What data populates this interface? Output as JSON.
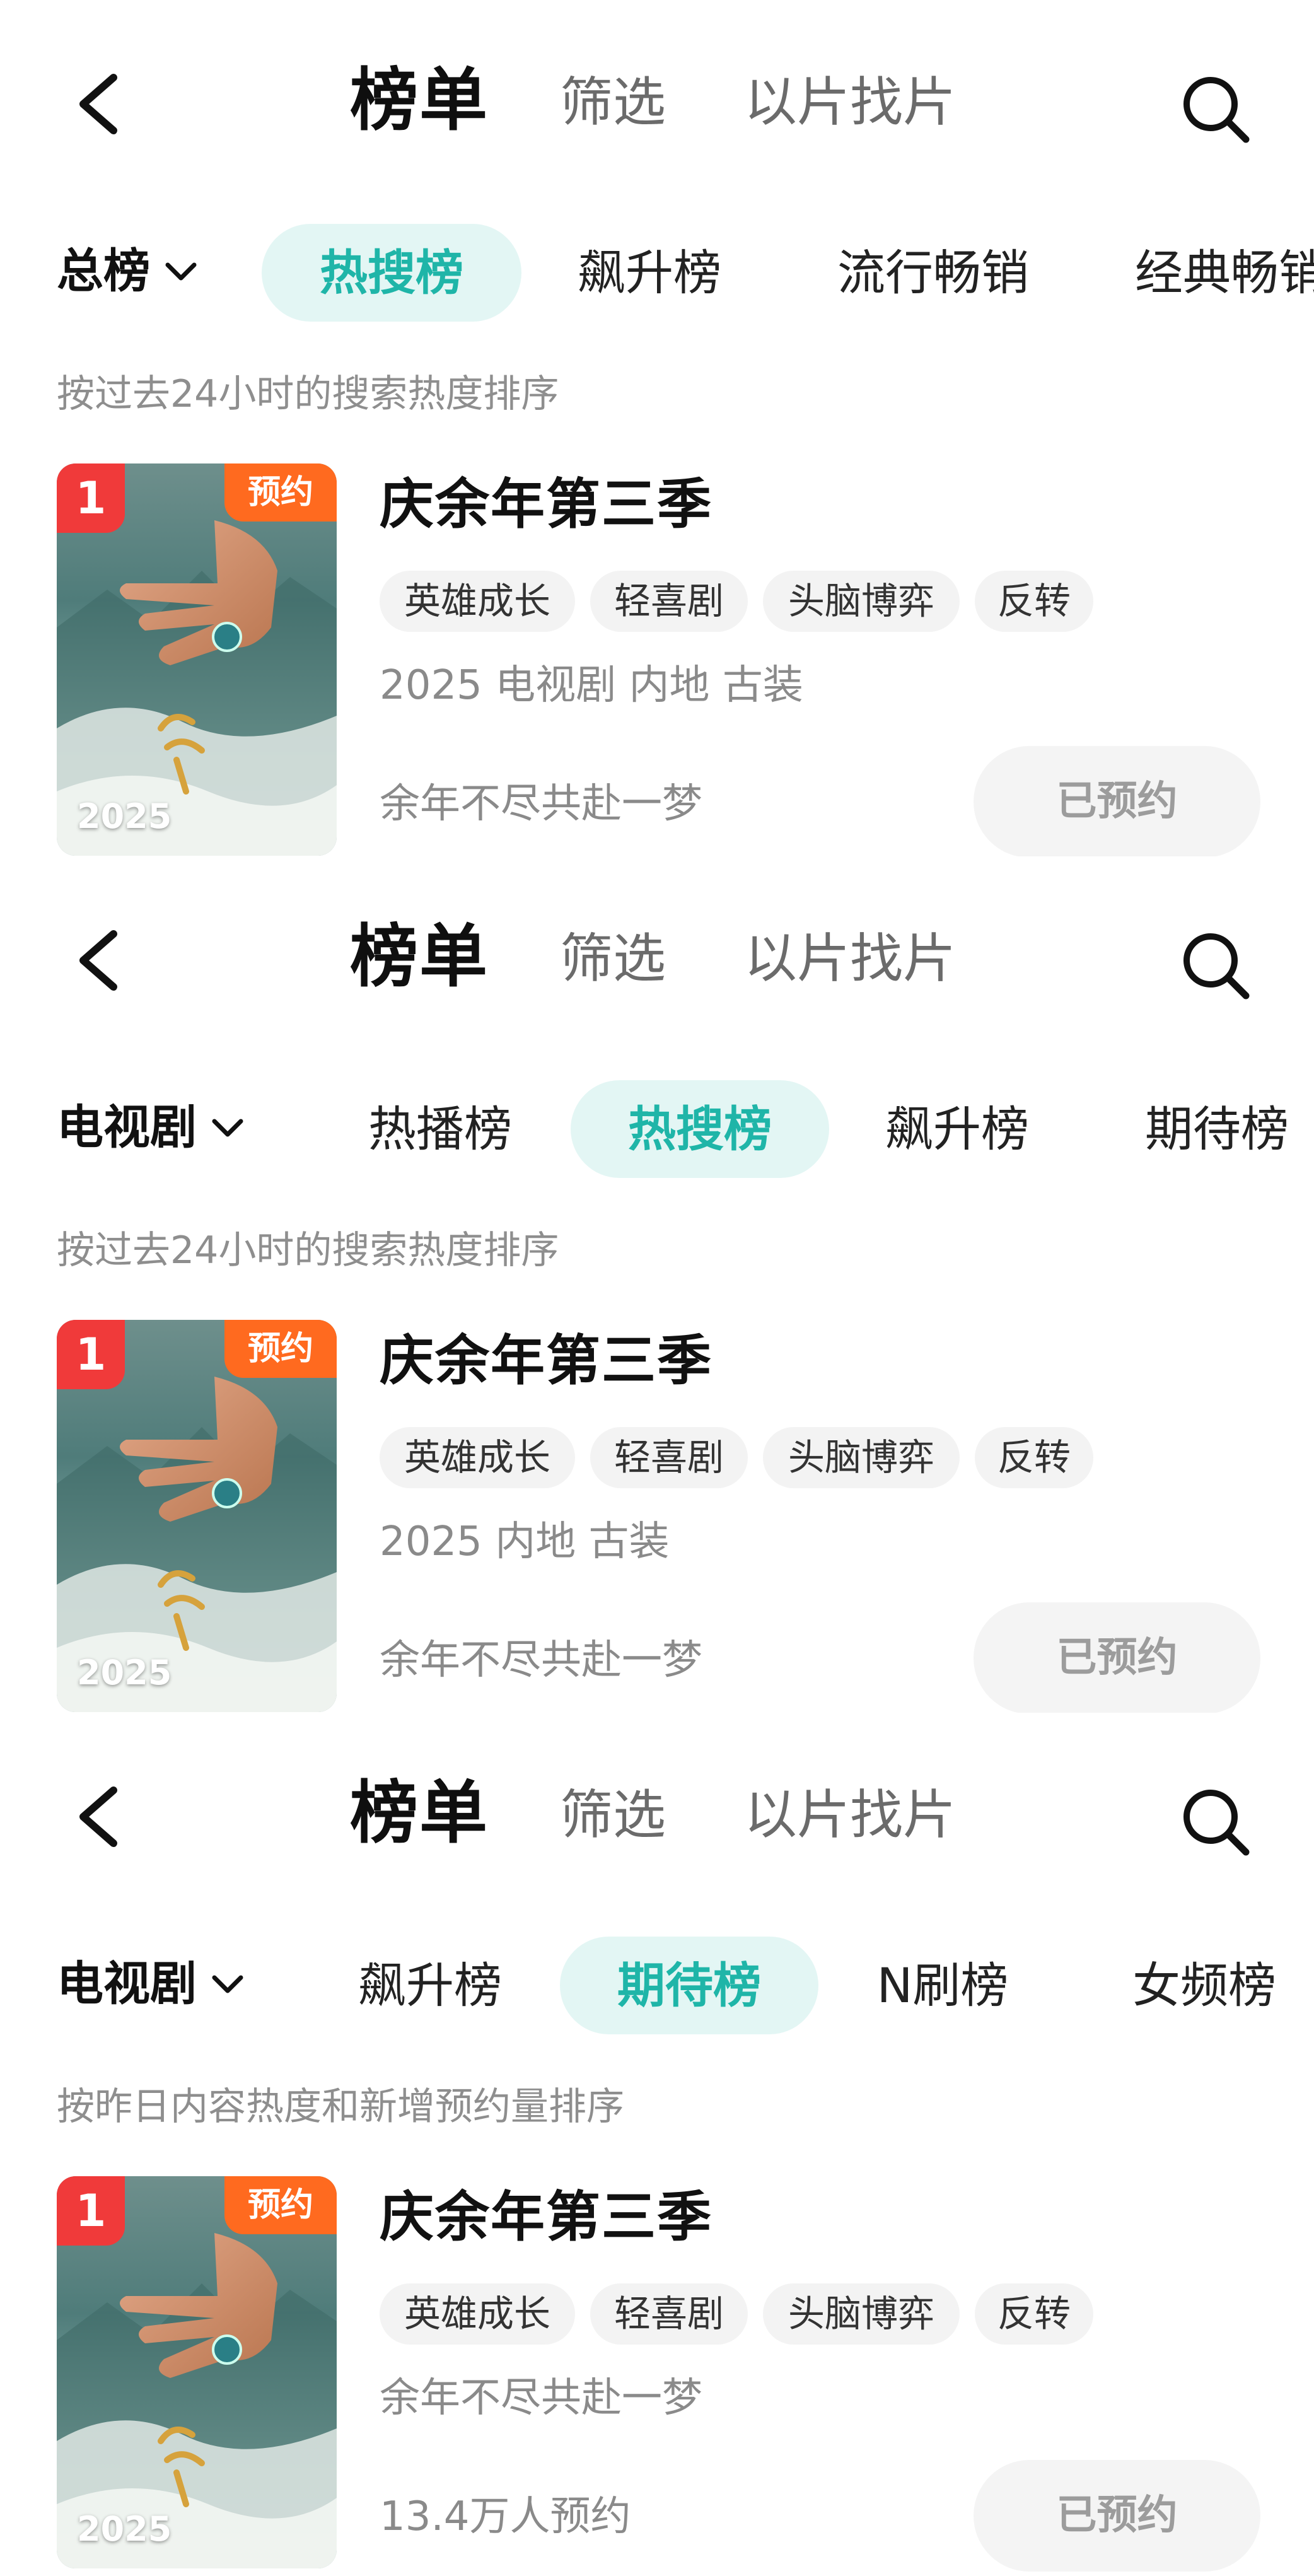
{
  "header": {
    "title": "榜单",
    "tabs": [
      "筛选",
      "以片找片"
    ],
    "back_icon": "chevron-left-icon",
    "search_icon": "search-icon"
  },
  "panels": [
    {
      "category": "总榜",
      "chips": [
        "热搜榜",
        "飙升榜",
        "流行畅销",
        "经典畅销"
      ],
      "active_chip": "热搜榜",
      "description": "按过去24小时的搜索热度排序",
      "card": {
        "rank": "1",
        "badge": "预约",
        "poster_year": "2025",
        "title": "庆余年第三季",
        "tags": [
          "英雄成长",
          "轻喜剧",
          "头脑博弈",
          "反转"
        ],
        "meta1": "2025 电视剧 内地 古装",
        "meta2": "余年不尽共赴一梦",
        "button": "已预约"
      }
    },
    {
      "category": "电视剧",
      "chips": [
        "热播榜",
        "热搜榜",
        "飙升榜",
        "期待榜"
      ],
      "active_chip": "热搜榜",
      "description": "按过去24小时的搜索热度排序",
      "card": {
        "rank": "1",
        "badge": "预约",
        "poster_year": "2025",
        "title": "庆余年第三季",
        "tags": [
          "英雄成长",
          "轻喜剧",
          "头脑博弈",
          "反转"
        ],
        "meta1": "2025 内地 古装",
        "meta2": "余年不尽共赴一梦",
        "button": "已预约"
      }
    },
    {
      "category": "电视剧",
      "chips": [
        "飙升榜",
        "期待榜",
        "N刷榜",
        "女频榜"
      ],
      "active_chip": "期待榜",
      "description": "按昨日内容热度和新增预约量排序",
      "card": {
        "rank": "1",
        "badge": "预约",
        "poster_year": "2025",
        "title": "庆余年第三季",
        "tags": [
          "英雄成长",
          "轻喜剧",
          "头脑博弈",
          "反转"
        ],
        "meta1": "余年不尽共赴一梦",
        "meta2": "13.4万人预约",
        "button": "已预约"
      }
    }
  ],
  "colors": {
    "accent": "#1fb5a8",
    "active_chip_bg": "#e3f6f4",
    "rank_badge": "#f03a3a",
    "reserve_badge": "#ff6a1f"
  }
}
